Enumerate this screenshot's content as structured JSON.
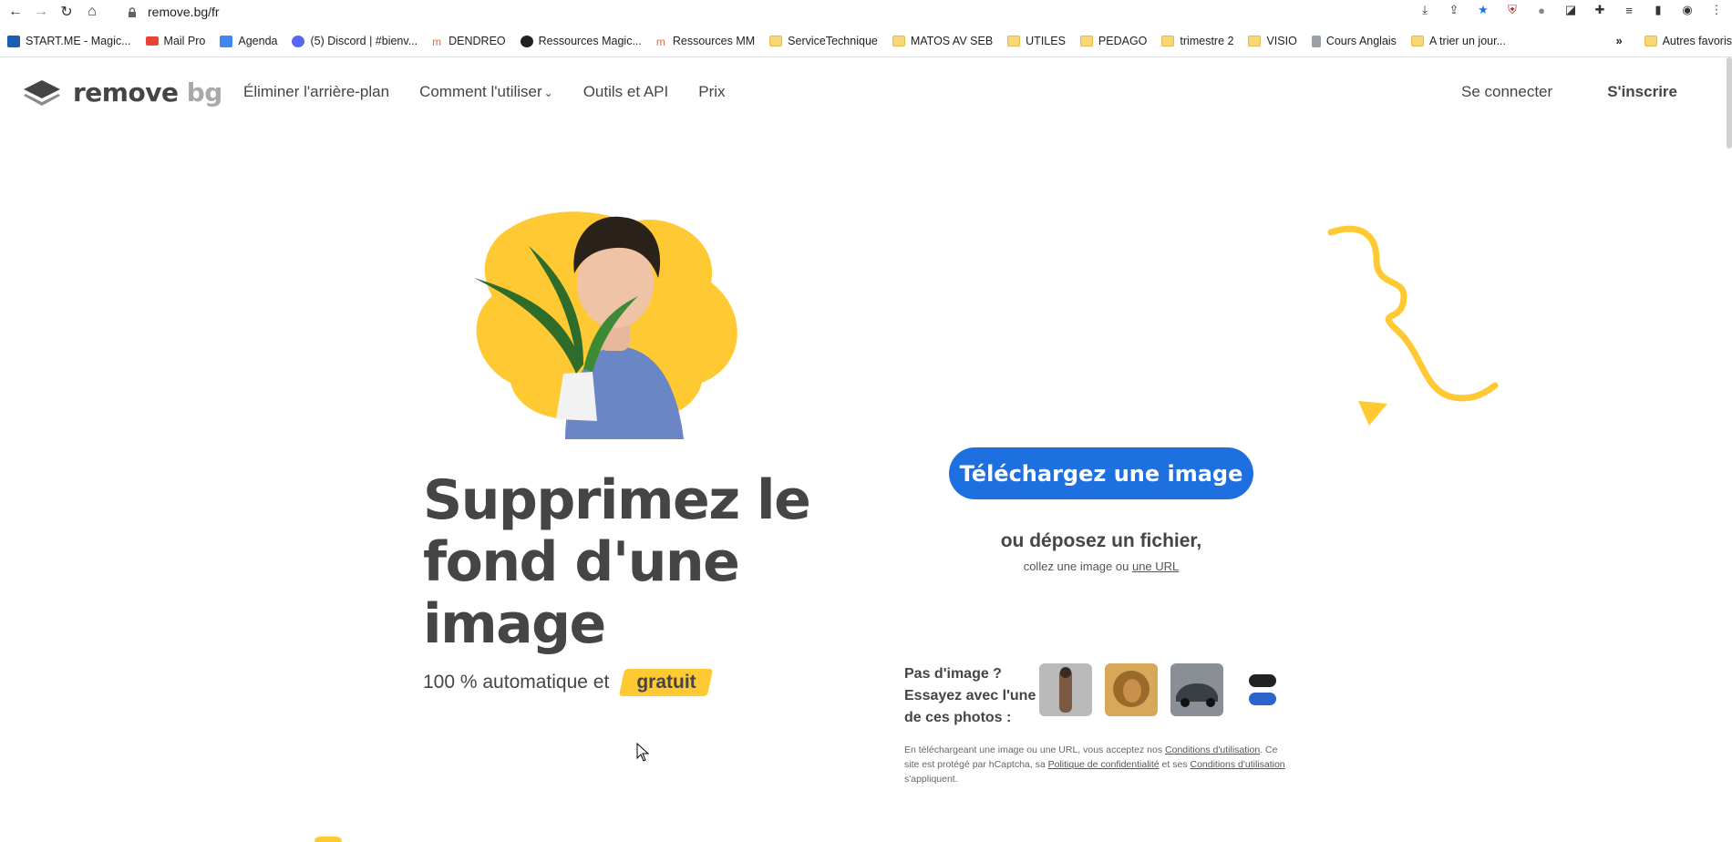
{
  "browser": {
    "url": "remove.bg/fr",
    "bookmarks": [
      {
        "label": "START.ME - Magic..."
      },
      {
        "label": "Mail Pro"
      },
      {
        "label": "Agenda"
      },
      {
        "label": "(5) Discord | #bienv..."
      },
      {
        "label": "DENDREO"
      },
      {
        "label": "Ressources Magic..."
      },
      {
        "label": "Ressources MM"
      },
      {
        "label": "ServiceTechnique"
      },
      {
        "label": "MATOS AV SEB"
      },
      {
        "label": "UTILES"
      },
      {
        "label": "PEDAGO"
      },
      {
        "label": "trimestre 2"
      },
      {
        "label": "VISIO"
      },
      {
        "label": "Cours Anglais"
      },
      {
        "label": "A trier un jour..."
      }
    ],
    "more_bookmarks": "»",
    "other_bookmarks": "Autres favoris"
  },
  "header": {
    "logo_main": "remove",
    "logo_bg": "bg",
    "nav": {
      "remove_bg": "Éliminer l'arrière-plan",
      "how_to": "Comment l'utiliser",
      "tools": "Outils et API",
      "pricing": "Prix"
    },
    "login": "Se connecter",
    "signup": "S'inscrire"
  },
  "hero": {
    "headline": "Supprimez le fond d'une image",
    "sub_prefix": "100 % automatique et",
    "sub_highlight": "gratuit"
  },
  "upload": {
    "button": "Téléchargez une image",
    "drop": "ou déposez un fichier,",
    "paste_prefix": "collez une image ou",
    "paste_link": "une URL"
  },
  "samples": {
    "label": "Pas d'image ? Essayez avec l'une de ces photos :"
  },
  "terms": {
    "p1": "En téléchargeant une image ou une URL, vous acceptez nos",
    "link1": "Conditions d'utilisation",
    "p2": ". Ce site est protégé par hCaptcha, sa",
    "link2": "Politique de confidentialité",
    "p3": "et ses",
    "link3": "Conditions d'utilisation",
    "p4": "s'appliquent."
  },
  "colors": {
    "accent_blue": "#1e6fe0",
    "accent_yellow": "#ffc933",
    "text": "#454545"
  }
}
